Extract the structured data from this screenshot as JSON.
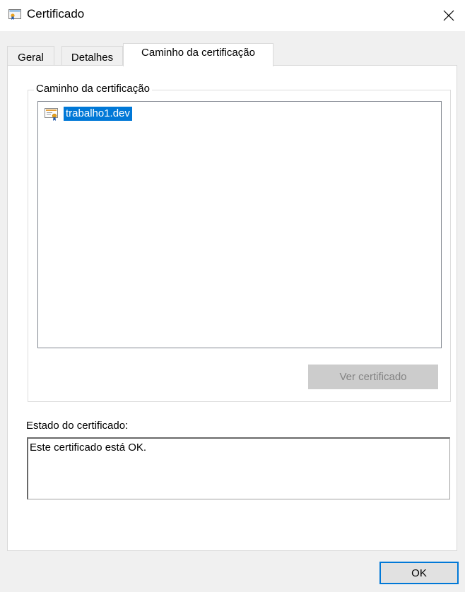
{
  "window": {
    "title": "Certificado",
    "icon": "certificate-icon",
    "close_glyph": "✕"
  },
  "tabs": [
    {
      "label": "Geral",
      "active": false
    },
    {
      "label": "Detalhes",
      "active": false
    },
    {
      "label": "Caminho da certificação",
      "active": true
    }
  ],
  "path_group": {
    "legend": "Caminho da certificação",
    "items": [
      {
        "label": "trabalho1.dev",
        "icon": "certificate-icon",
        "selected": true
      }
    ],
    "view_button": "Ver certificado"
  },
  "status": {
    "label": "Estado do certificado:",
    "text": "Este certificado está OK."
  },
  "footer": {
    "ok_label": "OK"
  },
  "colors": {
    "selection": "#0078d7",
    "window_bg": "#f0f0f0",
    "panel_bg": "#ffffff"
  }
}
